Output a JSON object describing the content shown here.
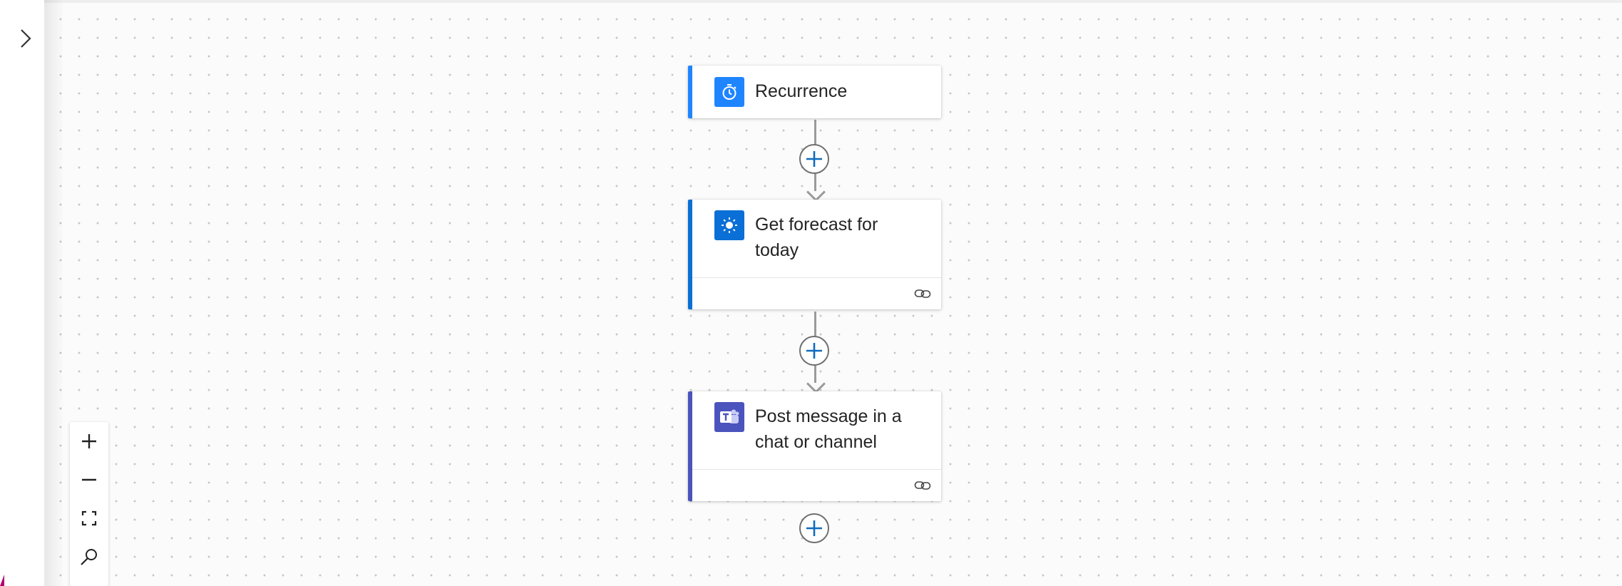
{
  "sidebar": {
    "expand_icon": "chevron-right-icon"
  },
  "flow": {
    "steps": [
      {
        "id": "recurrence",
        "title": "Recurrence",
        "icon": "alarm-clock-icon",
        "accent": "#1f85ff",
        "icon_bg": "#1f85ff"
      },
      {
        "id": "forecast",
        "title": "Get forecast for today",
        "title_lines": [
          "Get forecast for",
          "today"
        ],
        "icon": "sun-icon",
        "accent": "#0a6fd6",
        "icon_bg": "#0a6fd6",
        "footer_icon": "link-icon"
      },
      {
        "id": "teams",
        "title": "Post message in a chat or channel",
        "title_lines": [
          "Post message in a",
          "chat or channel"
        ],
        "icon": "teams-icon",
        "accent": "#4b53bc",
        "icon_bg": "#4b53bc",
        "footer_icon": "link-icon"
      }
    ],
    "add_step_icon": "plus-circle-icon"
  },
  "zoom_controls": {
    "items": [
      "zoom-in-icon",
      "zoom-out-icon",
      "fit-view-icon",
      "search-icon"
    ]
  },
  "colors": {
    "plus_accent": "#0f6cbd",
    "connector": "#9a9a9a"
  }
}
